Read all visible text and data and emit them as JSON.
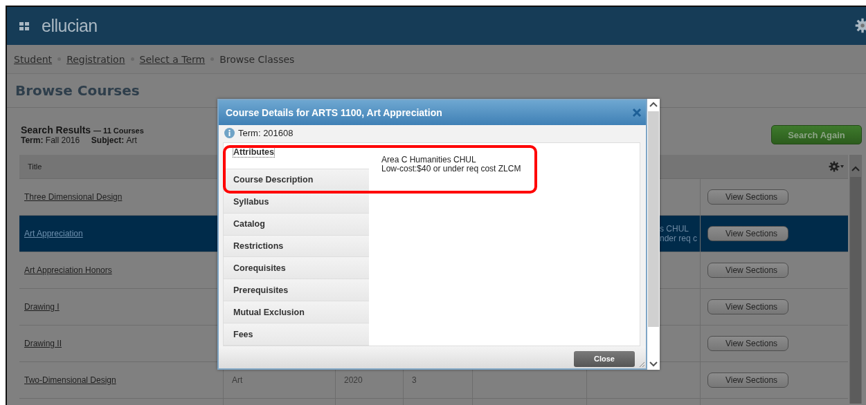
{
  "header": {
    "logo": "ellucian"
  },
  "breadcrumbs": [
    {
      "label": "Student",
      "link": true
    },
    {
      "label": "Registration",
      "link": true
    },
    {
      "label": "Select a Term",
      "link": true
    },
    {
      "label": "Browse Classes",
      "link": false
    }
  ],
  "page_title": "Browse Courses",
  "search_results": {
    "title": "Search Results",
    "count": "— 11 Courses",
    "term_label": "Term:",
    "term": "Fall 2016",
    "subject_label": "Subject:",
    "subject": "Art"
  },
  "search_again": "Search Again",
  "table": {
    "columns": [
      {
        "label": "Title"
      }
    ],
    "rows": [
      {
        "title": "Three Dimensional Design",
        "selected": false,
        "action": "View Sections"
      },
      {
        "title": "Art Appreciation",
        "selected": true,
        "attributes": [
          "s CHUL",
          "nder req c"
        ],
        "action": "View Sections"
      },
      {
        "title": "Art Appreciation Honors",
        "selected": false,
        "action": "View Sections"
      },
      {
        "title": "Drawing I",
        "selected": false,
        "action": "View Sections"
      },
      {
        "title": "Drawing II",
        "selected": false,
        "action": "View Sections"
      },
      {
        "title": "Two-Dimensional Design",
        "selected": false,
        "subject": "Art",
        "course_number": "2020",
        "hours": "3",
        "action": "View Sections"
      }
    ]
  },
  "dialog": {
    "title": "Course Details for ARTS 1100, Art Appreciation",
    "term_label": "Term:",
    "term": "201608",
    "tabs": [
      {
        "label": "Attributes",
        "selected": true
      },
      {
        "label": "Course Description",
        "selected": false
      },
      {
        "label": "Syllabus",
        "selected": false
      },
      {
        "label": "Catalog",
        "selected": false
      },
      {
        "label": "Restrictions",
        "selected": false
      },
      {
        "label": "Corequisites",
        "selected": false
      },
      {
        "label": "Prerequisites",
        "selected": false
      },
      {
        "label": "Mutual Exclusion",
        "selected": false
      },
      {
        "label": "Fees",
        "selected": false
      }
    ],
    "content": [
      "Area C Humanities CHUL",
      "Low-cost:$40 or under req cost ZLCM"
    ],
    "close": "Close"
  }
}
